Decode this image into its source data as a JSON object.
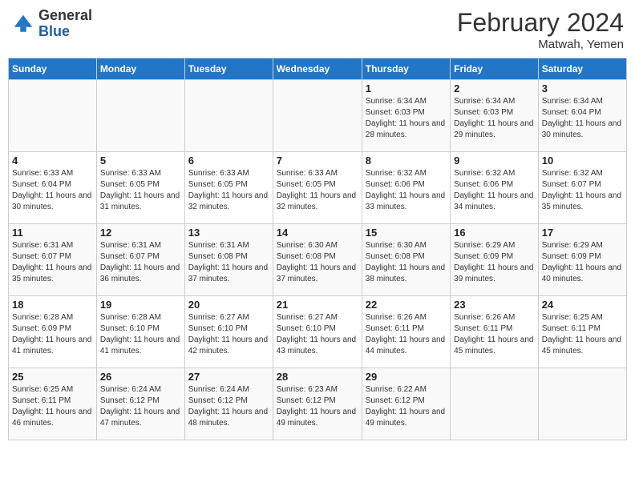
{
  "header": {
    "logo_general": "General",
    "logo_blue": "Blue",
    "title": "February 2024",
    "subtitle": "Matwah, Yemen"
  },
  "days_of_week": [
    "Sunday",
    "Monday",
    "Tuesday",
    "Wednesday",
    "Thursday",
    "Friday",
    "Saturday"
  ],
  "weeks": [
    [
      {
        "day": "",
        "info": ""
      },
      {
        "day": "",
        "info": ""
      },
      {
        "day": "",
        "info": ""
      },
      {
        "day": "",
        "info": ""
      },
      {
        "day": "1",
        "info": "Sunrise: 6:34 AM\nSunset: 6:03 PM\nDaylight: 11 hours and 28 minutes."
      },
      {
        "day": "2",
        "info": "Sunrise: 6:34 AM\nSunset: 6:03 PM\nDaylight: 11 hours and 29 minutes."
      },
      {
        "day": "3",
        "info": "Sunrise: 6:34 AM\nSunset: 6:04 PM\nDaylight: 11 hours and 30 minutes."
      }
    ],
    [
      {
        "day": "4",
        "info": "Sunrise: 6:33 AM\nSunset: 6:04 PM\nDaylight: 11 hours and 30 minutes."
      },
      {
        "day": "5",
        "info": "Sunrise: 6:33 AM\nSunset: 6:05 PM\nDaylight: 11 hours and 31 minutes."
      },
      {
        "day": "6",
        "info": "Sunrise: 6:33 AM\nSunset: 6:05 PM\nDaylight: 11 hours and 32 minutes."
      },
      {
        "day": "7",
        "info": "Sunrise: 6:33 AM\nSunset: 6:05 PM\nDaylight: 11 hours and 32 minutes."
      },
      {
        "day": "8",
        "info": "Sunrise: 6:32 AM\nSunset: 6:06 PM\nDaylight: 11 hours and 33 minutes."
      },
      {
        "day": "9",
        "info": "Sunrise: 6:32 AM\nSunset: 6:06 PM\nDaylight: 11 hours and 34 minutes."
      },
      {
        "day": "10",
        "info": "Sunrise: 6:32 AM\nSunset: 6:07 PM\nDaylight: 11 hours and 35 minutes."
      }
    ],
    [
      {
        "day": "11",
        "info": "Sunrise: 6:31 AM\nSunset: 6:07 PM\nDaylight: 11 hours and 35 minutes."
      },
      {
        "day": "12",
        "info": "Sunrise: 6:31 AM\nSunset: 6:07 PM\nDaylight: 11 hours and 36 minutes."
      },
      {
        "day": "13",
        "info": "Sunrise: 6:31 AM\nSunset: 6:08 PM\nDaylight: 11 hours and 37 minutes."
      },
      {
        "day": "14",
        "info": "Sunrise: 6:30 AM\nSunset: 6:08 PM\nDaylight: 11 hours and 37 minutes."
      },
      {
        "day": "15",
        "info": "Sunrise: 6:30 AM\nSunset: 6:08 PM\nDaylight: 11 hours and 38 minutes."
      },
      {
        "day": "16",
        "info": "Sunrise: 6:29 AM\nSunset: 6:09 PM\nDaylight: 11 hours and 39 minutes."
      },
      {
        "day": "17",
        "info": "Sunrise: 6:29 AM\nSunset: 6:09 PM\nDaylight: 11 hours and 40 minutes."
      }
    ],
    [
      {
        "day": "18",
        "info": "Sunrise: 6:28 AM\nSunset: 6:09 PM\nDaylight: 11 hours and 41 minutes."
      },
      {
        "day": "19",
        "info": "Sunrise: 6:28 AM\nSunset: 6:10 PM\nDaylight: 11 hours and 41 minutes."
      },
      {
        "day": "20",
        "info": "Sunrise: 6:27 AM\nSunset: 6:10 PM\nDaylight: 11 hours and 42 minutes."
      },
      {
        "day": "21",
        "info": "Sunrise: 6:27 AM\nSunset: 6:10 PM\nDaylight: 11 hours and 43 minutes."
      },
      {
        "day": "22",
        "info": "Sunrise: 6:26 AM\nSunset: 6:11 PM\nDaylight: 11 hours and 44 minutes."
      },
      {
        "day": "23",
        "info": "Sunrise: 6:26 AM\nSunset: 6:11 PM\nDaylight: 11 hours and 45 minutes."
      },
      {
        "day": "24",
        "info": "Sunrise: 6:25 AM\nSunset: 6:11 PM\nDaylight: 11 hours and 45 minutes."
      }
    ],
    [
      {
        "day": "25",
        "info": "Sunrise: 6:25 AM\nSunset: 6:11 PM\nDaylight: 11 hours and 46 minutes."
      },
      {
        "day": "26",
        "info": "Sunrise: 6:24 AM\nSunset: 6:12 PM\nDaylight: 11 hours and 47 minutes."
      },
      {
        "day": "27",
        "info": "Sunrise: 6:24 AM\nSunset: 6:12 PM\nDaylight: 11 hours and 48 minutes."
      },
      {
        "day": "28",
        "info": "Sunrise: 6:23 AM\nSunset: 6:12 PM\nDaylight: 11 hours and 49 minutes."
      },
      {
        "day": "29",
        "info": "Sunrise: 6:22 AM\nSunset: 6:12 PM\nDaylight: 11 hours and 49 minutes."
      },
      {
        "day": "",
        "info": ""
      },
      {
        "day": "",
        "info": ""
      }
    ]
  ]
}
